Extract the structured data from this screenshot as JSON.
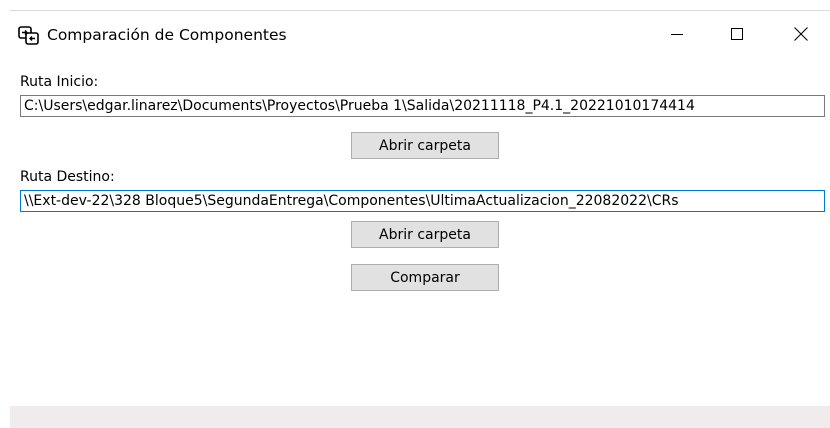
{
  "window": {
    "title": "Comparación de Componentes",
    "icon": "compare-app-icon"
  },
  "controls": {
    "minimize": "minimize-icon",
    "maximize": "maximize-icon",
    "close": "close-icon"
  },
  "origin": {
    "label": "Ruta Inicio:",
    "value": "C:\\Users\\edgar.linarez\\Documents\\Proyectos\\Prueba 1\\Salida\\20211118_P4.1_20221010174414",
    "browse_label": "Abrir carpeta"
  },
  "destination": {
    "label": "Ruta Destino:",
    "value": "\\\\Ext-dev-22\\328 Bloque5\\SegundaEntrega\\Componentes\\UltimaActualizacion_22082022\\CRs",
    "browse_label": "Abrir carpeta"
  },
  "compare": {
    "label": "Comparar"
  },
  "colors": {
    "focus_border": "#0078d7",
    "button_bg": "#e1e1e1",
    "statusbar_bg": "#f0eced"
  }
}
